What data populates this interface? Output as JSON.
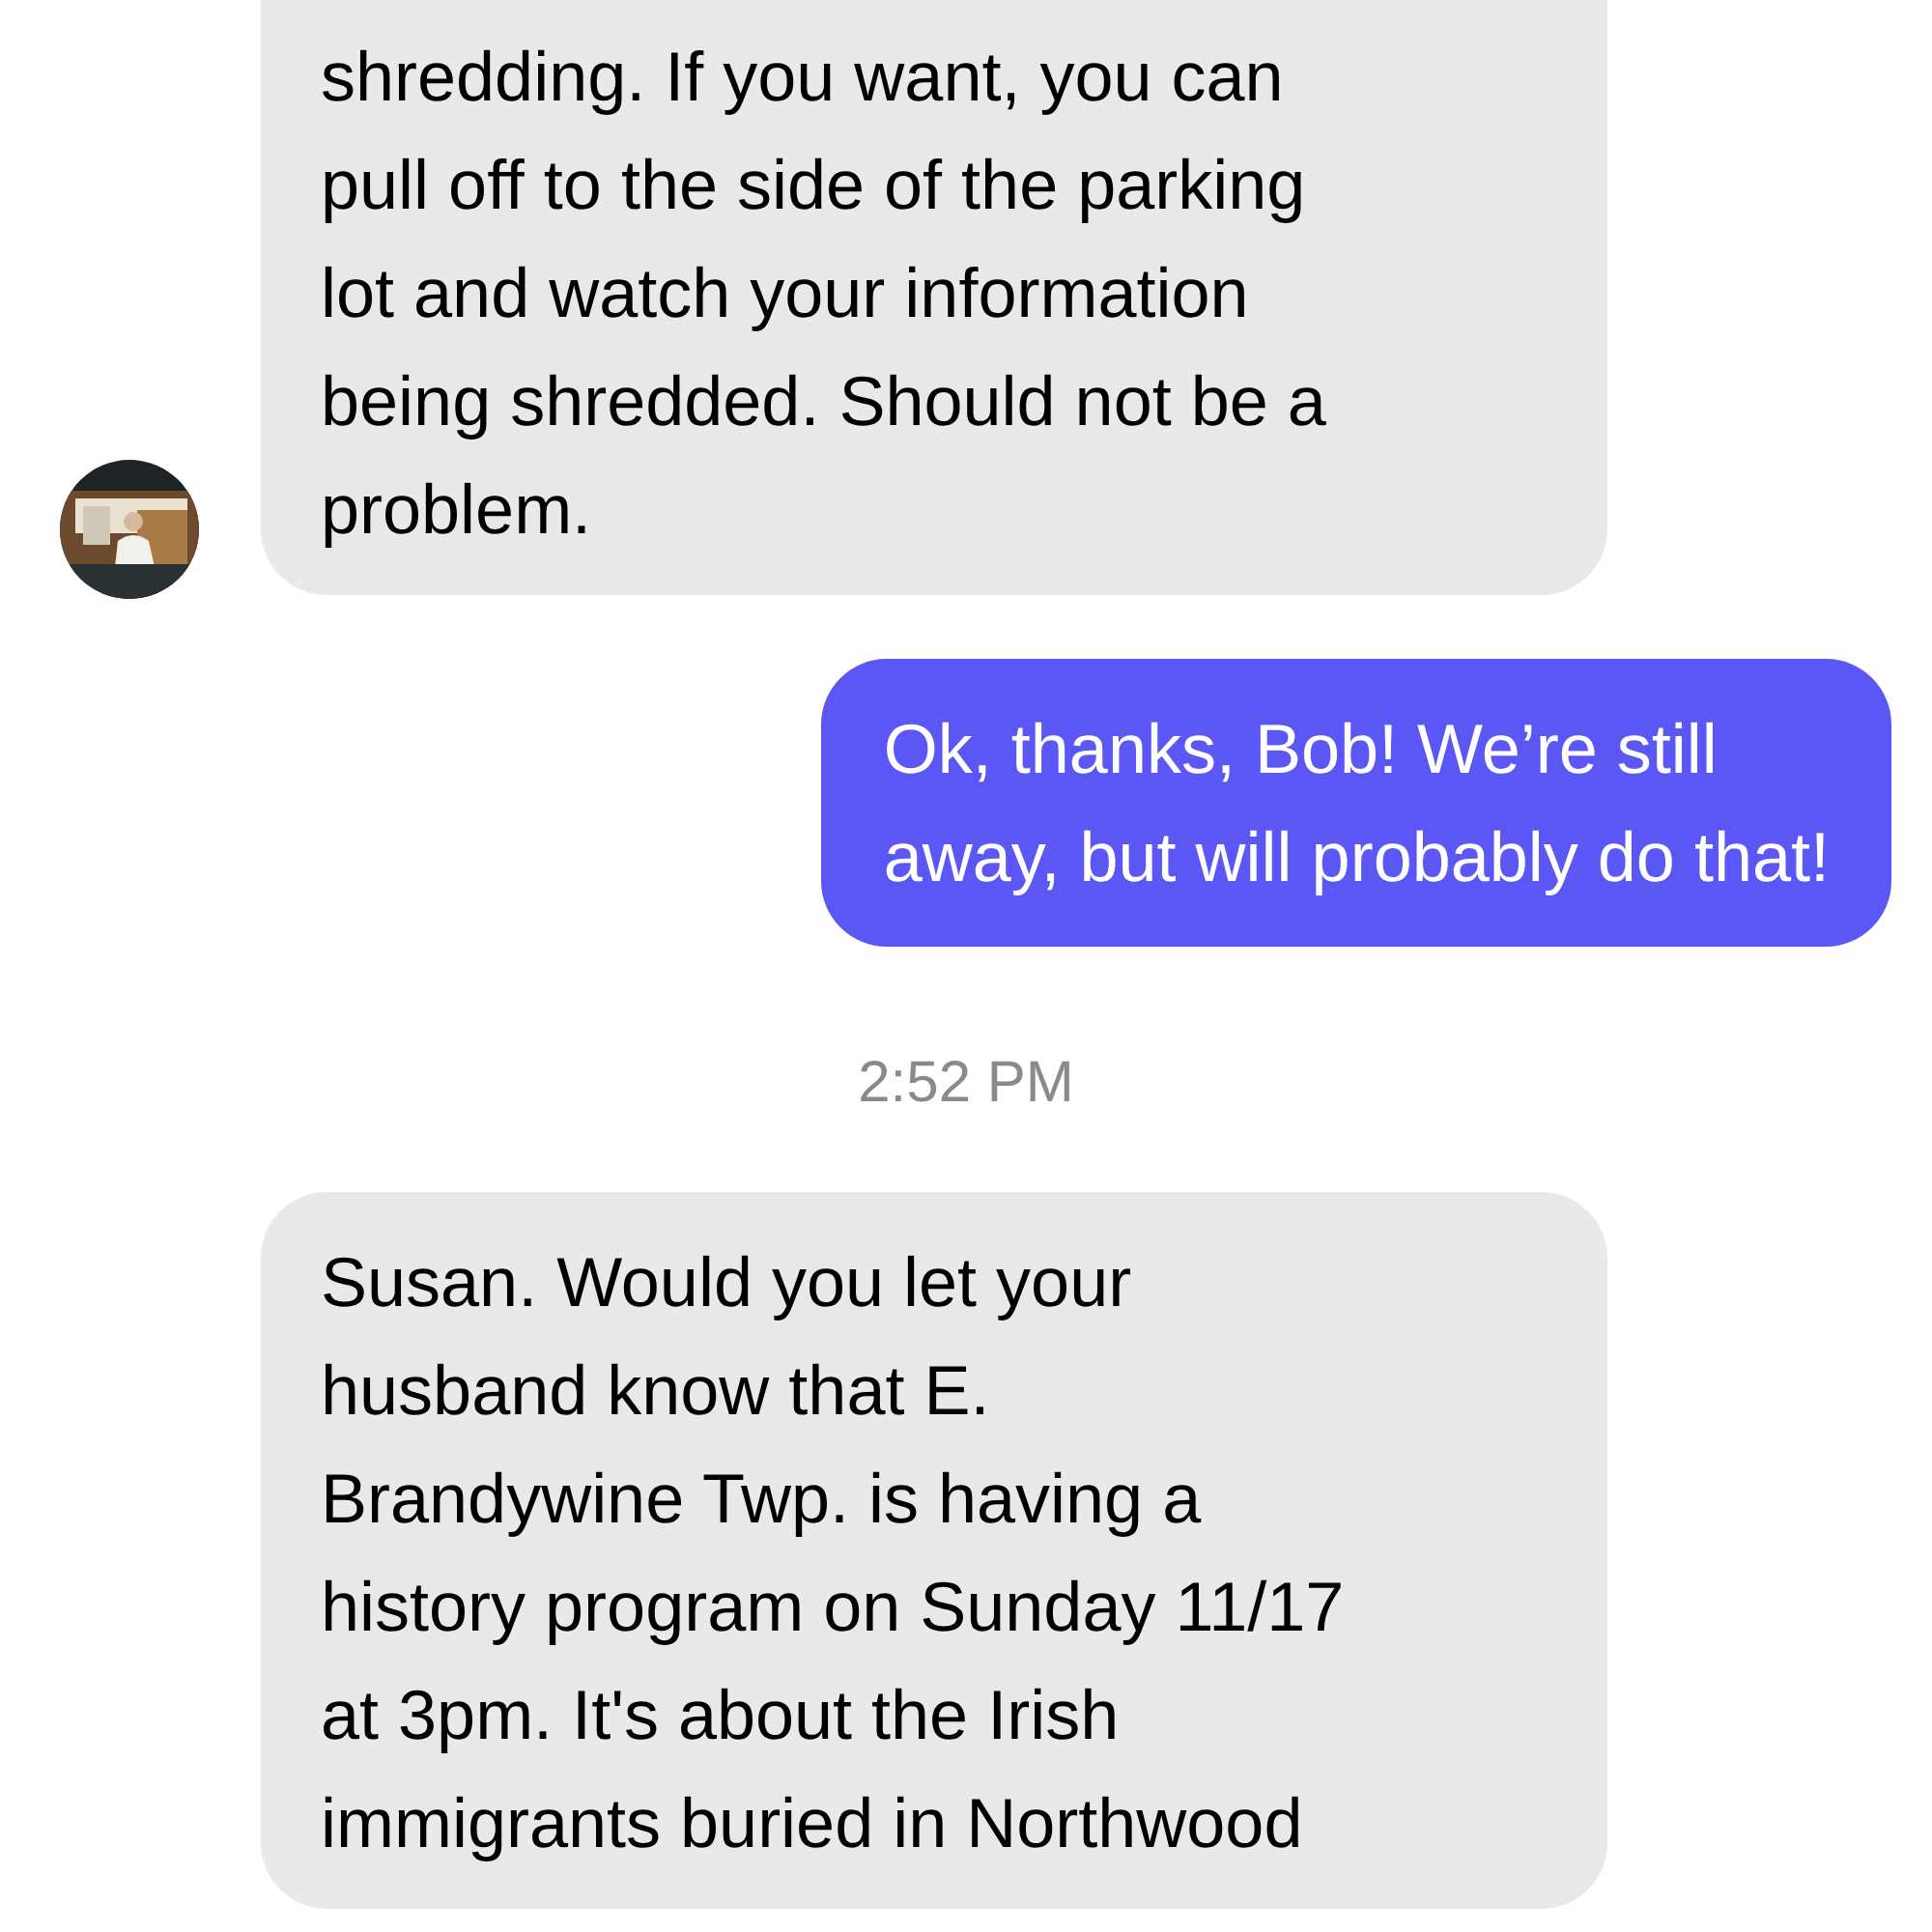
{
  "messages": [
    {
      "kind": "incoming",
      "avatar": true,
      "text": "shredding. If you want, you can\npull off to the side of the parking\nlot and watch your information\nbeing shredded. Should not be a\nproblem."
    },
    {
      "kind": "outgoing",
      "text": "Ok, thanks, Bob! We’re still\naway, but will probably do that!"
    },
    {
      "kind": "timestamp",
      "text": "2:52 PM"
    },
    {
      "kind": "incoming",
      "avatar": false,
      "text": "Susan. Would you let your\nhusband know that E.\nBrandywine Twp. is having a\nhistory program on Sunday 11/17\nat 3pm. It's about the Irish\nimmigrants buried in Northwood"
    }
  ]
}
